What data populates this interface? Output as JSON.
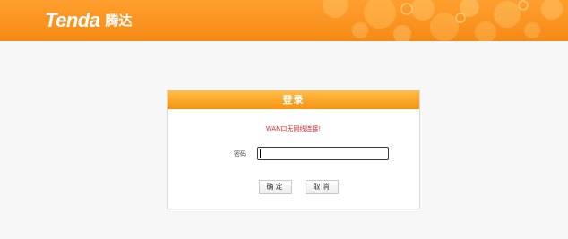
{
  "header": {
    "brand": "Tenda",
    "brand_cn": "腾达"
  },
  "login": {
    "title": "登录",
    "error": "WAN口无网线连接!",
    "password_label": "密码",
    "password_value": "",
    "ok_label": "确定",
    "cancel_label": "取消"
  },
  "colors": {
    "header_orange": "#f68a16",
    "title_orange": "#f7930e",
    "error_red": "#e02424"
  }
}
